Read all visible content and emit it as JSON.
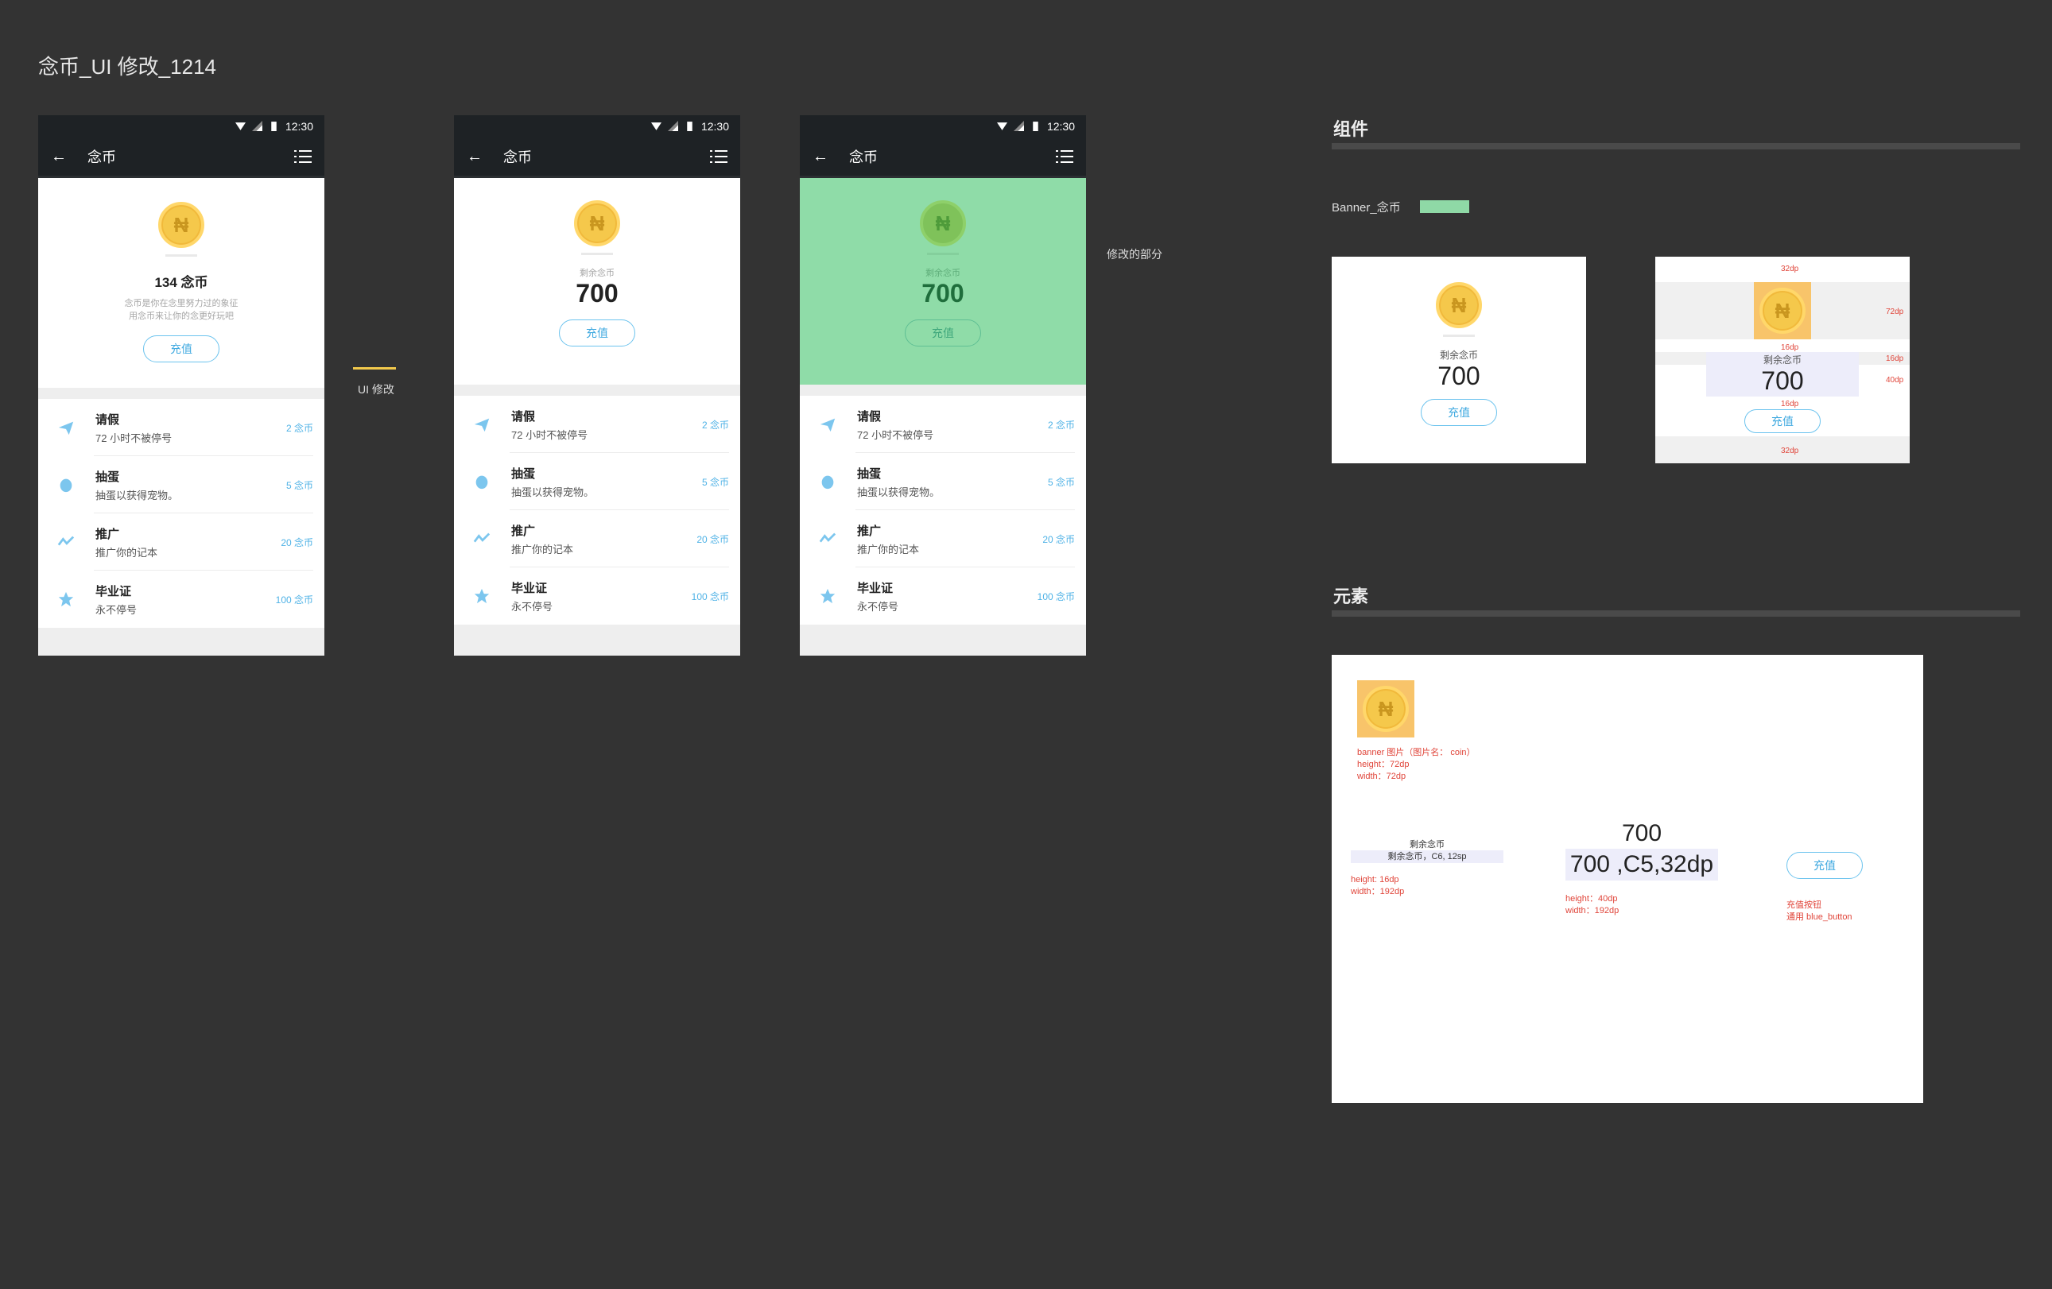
{
  "page_title": "念币_UI 修改_1214",
  "status": {
    "time": "12:30"
  },
  "appbar": {
    "title": "念币"
  },
  "phone1": {
    "amount_text": "134 念币",
    "desc1": "念币是你在念里努力过的象征",
    "desc2": "用念币来让你的念更好玩吧",
    "button": "充值"
  },
  "phone2": {
    "caption": "剩余念币",
    "amount": "700",
    "button": "充值"
  },
  "phone3": {
    "caption": "剩余念币",
    "amount": "700",
    "button": "充值"
  },
  "list_items": [
    {
      "title": "请假",
      "subtitle": "72 小时不被停号",
      "price": "2 念币",
      "icon": "plane-icon"
    },
    {
      "title": "抽蛋",
      "subtitle": "抽蛋以获得宠物。",
      "price": "5 念币",
      "icon": "egg-icon"
    },
    {
      "title": "推广",
      "subtitle": "推广你的记本",
      "price": "20 念币",
      "icon": "promote-icon"
    },
    {
      "title": "毕业证",
      "subtitle": "永不停号",
      "price": "100 念币",
      "icon": "star-icon"
    }
  ],
  "arrow_label": "UI 修改",
  "modified_label": "修改的部分",
  "components": {
    "title": "组件",
    "legend_label": "Banner_念币",
    "legend_color": "#8fd9a6",
    "banner": {
      "caption": "剩余念币",
      "amount": "700",
      "button": "充值"
    },
    "spec": {
      "caption": "剩余念币",
      "amount": "700",
      "button": "充值",
      "m32a": "32dp",
      "m72": "72dp",
      "m16a": "16dp",
      "m16b": "16dp",
      "m40": "40dp",
      "m16c": "16dp",
      "m32b": "32dp"
    }
  },
  "elements": {
    "title": "元素",
    "coin_note1": "banner 图片（图片名： coin）",
    "coin_note2": "height：72dp",
    "coin_note3": "width：72dp",
    "cap_label": "剩余念币",
    "cap_spec": "剩余念币，C6, 12sp",
    "cap_h": "height: 16dp",
    "cap_w": "width：192dp",
    "amt_label": "700",
    "amt_spec": "700 ,C5,32dp",
    "amt_h": "height：40dp",
    "amt_w": "width：192dp",
    "btn_label": "充值",
    "btn_note1": "充值按钮",
    "btn_note2": "通用 blue_button"
  },
  "colors": {
    "accent_blue": "#4fb2e6",
    "banner_green": "#8fdca8",
    "arrow_yellow": "#f2c94c",
    "annotation_red": "#e0453a"
  }
}
